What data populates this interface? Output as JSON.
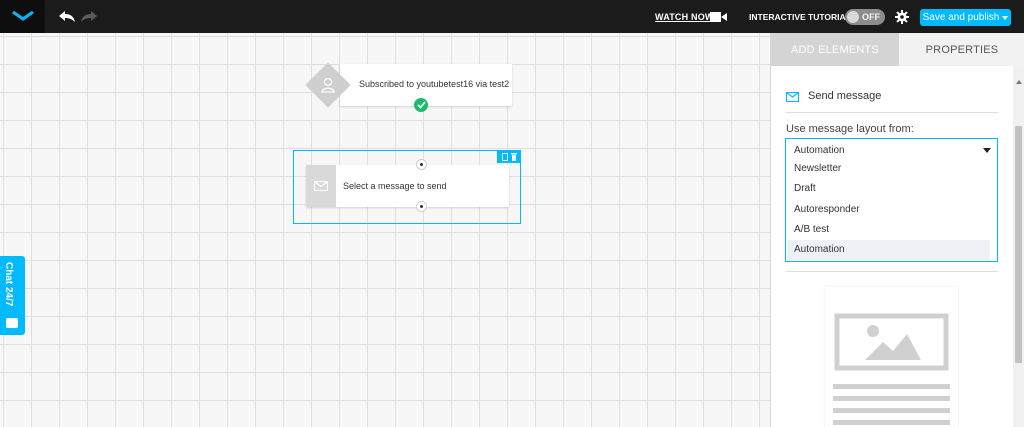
{
  "topbar": {
    "logo_icon": "envelope-logo-icon",
    "undo_icon": "undo-icon",
    "redo_icon": "redo-icon",
    "watch_now": "WATCH NOW",
    "video_icon": "video-camera-icon",
    "interactive_tutorial": "INTERACTIVE TUTORIAL",
    "tutorial_toggle": "OFF",
    "settings_icon": "gear-icon",
    "save_button": "Save and publish"
  },
  "canvas": {
    "trigger_text": "Subscribed to youtubetest16 via test2",
    "action_text": "Select a message to send",
    "chat_label": "Chat 24/7"
  },
  "panel": {
    "tabs": [
      {
        "label": "ADD ELEMENTS"
      },
      {
        "label": "PROPERTIES"
      }
    ],
    "section_title": "Send message",
    "use_layout_label": "Use message layout from:",
    "dropdown": {
      "selected": "Automation",
      "options": [
        "Newsletter",
        "Draft",
        "Autoresponder",
        "A/B test",
        "Automation"
      ]
    }
  },
  "colors": {
    "accent": "#00baff",
    "success": "#1bbc6c",
    "topbar": "#1b1b1b"
  }
}
